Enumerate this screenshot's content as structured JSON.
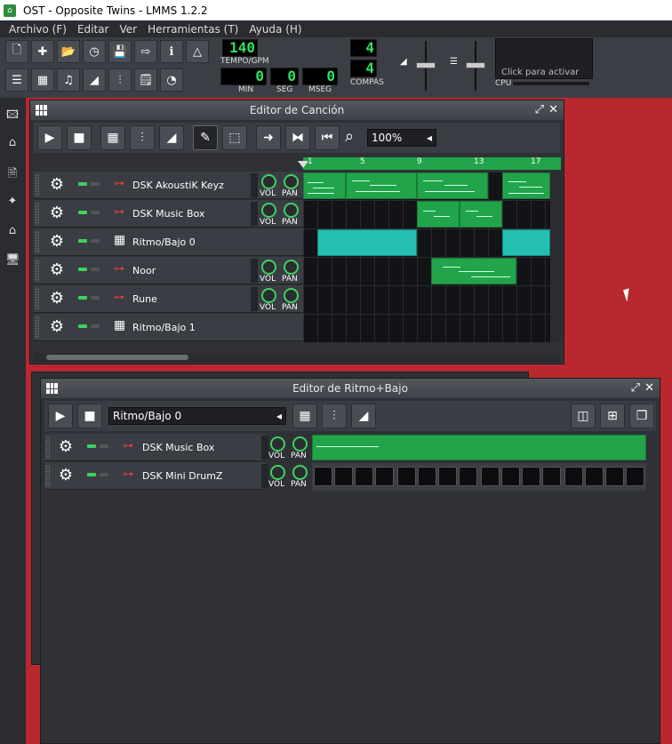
{
  "window": {
    "title": "OST - Opposite Twins - LMMS 1.2.2"
  },
  "menu": [
    "Archivo (F)",
    "Editar",
    "Ver",
    "Herramientas (T)",
    "Ayuda (H)"
  ],
  "lcd": {
    "tempo": "140",
    "tempo_label": "TEMPO/GPM",
    "min": "0",
    "min_label": "MIN",
    "sec": "0",
    "sec_label": "SEG",
    "msec": "0",
    "msec_label": "MSEG",
    "sig_num": "4",
    "sig_den": "4",
    "sig_label": "COMPÁS"
  },
  "cpu": {
    "hint": "Click para activar",
    "label": "CPU"
  },
  "song_editor": {
    "title": "Editor de Canción",
    "zoom": "100%",
    "ruler": [
      "1",
      "5",
      "9",
      "13",
      "17"
    ],
    "tracks": [
      {
        "name": "DSK AkoustiK Keyz",
        "kind": "instrument"
      },
      {
        "name": "DSK Music Box",
        "kind": "instrument"
      },
      {
        "name": "Ritmo/Bajo 0",
        "kind": "beat"
      },
      {
        "name": "Noor",
        "kind": "instrument"
      },
      {
        "name": "Rune",
        "kind": "instrument"
      },
      {
        "name": "Ritmo/Bajo 1",
        "kind": "beat"
      }
    ],
    "vol_label": "VOL",
    "pan_label": "PAN"
  },
  "beat_editor": {
    "title": "Editor de Ritmo+Bajo",
    "selected_pattern": "Ritmo/Bajo 0",
    "tracks": [
      {
        "name": "DSK Music Box"
      },
      {
        "name": "DSK Mini DrumZ"
      }
    ],
    "vol_label": "VOL",
    "pan_label": "PAN"
  },
  "colors": {
    "accent": "#22a44a",
    "teal": "#23c0b2",
    "lcd": "#30e060",
    "background": "#b8282e"
  }
}
